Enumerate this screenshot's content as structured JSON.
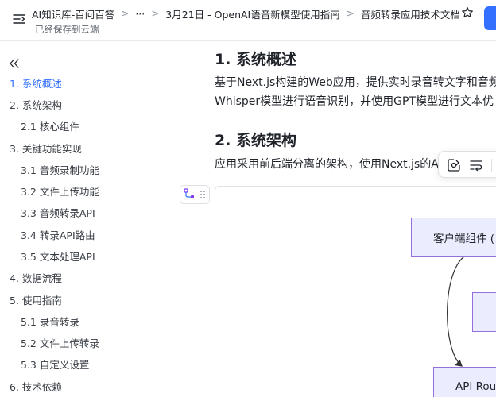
{
  "header": {
    "crumbs": [
      "AI知识库-百问百答",
      "···",
      "3月21日 - OpenAI语音新模型使用指南",
      "音频转录应用技术文档"
    ],
    "saved_status": "已经保存到云端"
  },
  "toc": {
    "items": [
      {
        "label": "1. 系统概述",
        "level": 1,
        "active": true
      },
      {
        "label": "2. 系统架构",
        "level": 1
      },
      {
        "label": "2.1 核心组件",
        "level": 2
      },
      {
        "label": "3. 关键功能实现",
        "level": 1
      },
      {
        "label": "3.1 音频录制功能",
        "level": 2
      },
      {
        "label": "3.2 文件上传功能",
        "level": 2
      },
      {
        "label": "3.3 音频转录API",
        "level": 2
      },
      {
        "label": "3.4 转录API路由",
        "level": 2
      },
      {
        "label": "3.5 文本处理API",
        "level": 2
      },
      {
        "label": "4. 数据流程",
        "level": 1
      },
      {
        "label": "5. 使用指南",
        "level": 1
      },
      {
        "label": "5.1 录音转录",
        "level": 2
      },
      {
        "label": "5.2 文件上传转录",
        "level": 2
      },
      {
        "label": "5.3 自定义设置",
        "level": 2
      },
      {
        "label": "6. 技术依赖",
        "level": 1
      }
    ]
  },
  "content": {
    "section1_heading": "1. 系统概述",
    "section1_line1": "基于Next.js构建的Web应用，提供实时录音转文字和音频",
    "section1_line2": "Whisper模型进行语音识别，并使用GPT模型进行文本优",
    "section2_heading": "2. 系统架构",
    "section2_line1": "应用采用前后端分离的架构，使用Next.js的A"
  },
  "diagram": {
    "node_client": "客户端组件 (",
    "node_api": "API Rout"
  },
  "colors": {
    "accent": "#3370ff",
    "node_fill": "#ececff",
    "node_border": "#9370db"
  }
}
